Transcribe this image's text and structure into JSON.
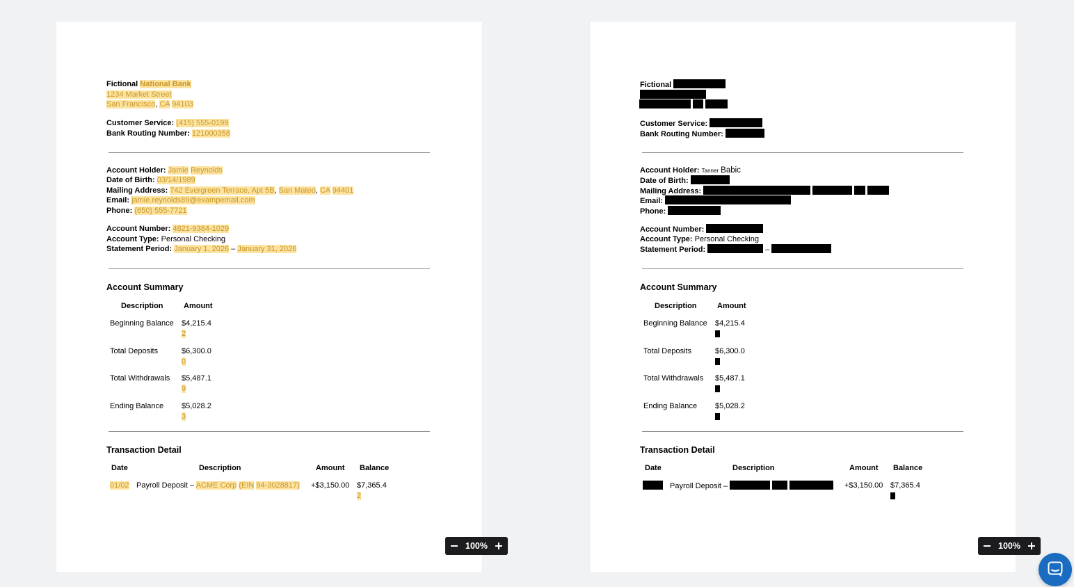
{
  "header": {
    "fictional": "Fictional",
    "bank_word": "National Bank",
    "street": "1234 Market Street",
    "city": "San Francisco",
    "state": "CA",
    "zip": "94103",
    "customer_service_label": "Customer Service:",
    "customer_service_value": "(415) 555-0199",
    "routing_label": "Bank Routing Number:",
    "routing_value": "121000358"
  },
  "holder": {
    "name_label": "Account Holder:",
    "first_name": "Jamie",
    "last_name": "Reynolds",
    "redacted_first_name": "Tanner",
    "redacted_last_name": "Babic",
    "dob_label": "Date of Birth:",
    "dob_value": "03/14/1989",
    "address_label": "Mailing Address:",
    "address_street": "742 Evergreen Terrace, Apt 5B",
    "address_city": "San Mateo",
    "address_state": "CA",
    "address_zip": "94401",
    "email_label": "Email:",
    "email_value": "jamie.reynolds89@exampemail.com",
    "phone_label": "Phone:",
    "phone_value": "(650) 555-7721"
  },
  "account": {
    "number_label": "Account Number:",
    "number_value": "4821-9384-1029",
    "type_label": "Account Type:",
    "type_value": "Personal Checking",
    "period_label": "Statement Period:",
    "period_start": "January 1, 2026",
    "period_dash": "–",
    "period_end": "January 31, 2026"
  },
  "summary": {
    "title": "Account Summary",
    "col_description": "Description",
    "col_amount": "Amount",
    "rows": [
      {
        "description": "Beginning Balance",
        "amount": "$4,215.4",
        "amount_tail": "2"
      },
      {
        "description": "Total Deposits",
        "amount": "$6,300.0",
        "amount_tail": "0"
      },
      {
        "description": "Total Withdrawals",
        "amount": "$5,487.1",
        "amount_tail": "9"
      },
      {
        "description": "Ending Balance",
        "amount": "$5,028.2",
        "amount_tail": "3"
      }
    ]
  },
  "transactions": {
    "title": "Transaction Detail",
    "col_date": "Date",
    "col_description": "Description",
    "col_amount": "Amount",
    "col_balance": "Balance",
    "rows": [
      {
        "date": "01/02",
        "desc_prefix": "Payroll Deposit –",
        "desc_company": "ACME Corp",
        "desc_ein_label": "(EIN",
        "desc_ein_value": "94-3028817)",
        "amount": "+$3,150.00",
        "balance": "$7,365.4",
        "balance_tail": "2"
      }
    ]
  },
  "viewer": {
    "zoom_label": "100%"
  },
  "colors": {
    "highlight_bg": "#fde3a0",
    "highlight_text": "#c7962a",
    "redaction": "#000000",
    "zoom_bar": "#1c1c1e",
    "chat_button": "#1a6cc0"
  },
  "icons": [
    "zoom-out-icon",
    "zoom-in-icon",
    "chat-icon"
  ]
}
